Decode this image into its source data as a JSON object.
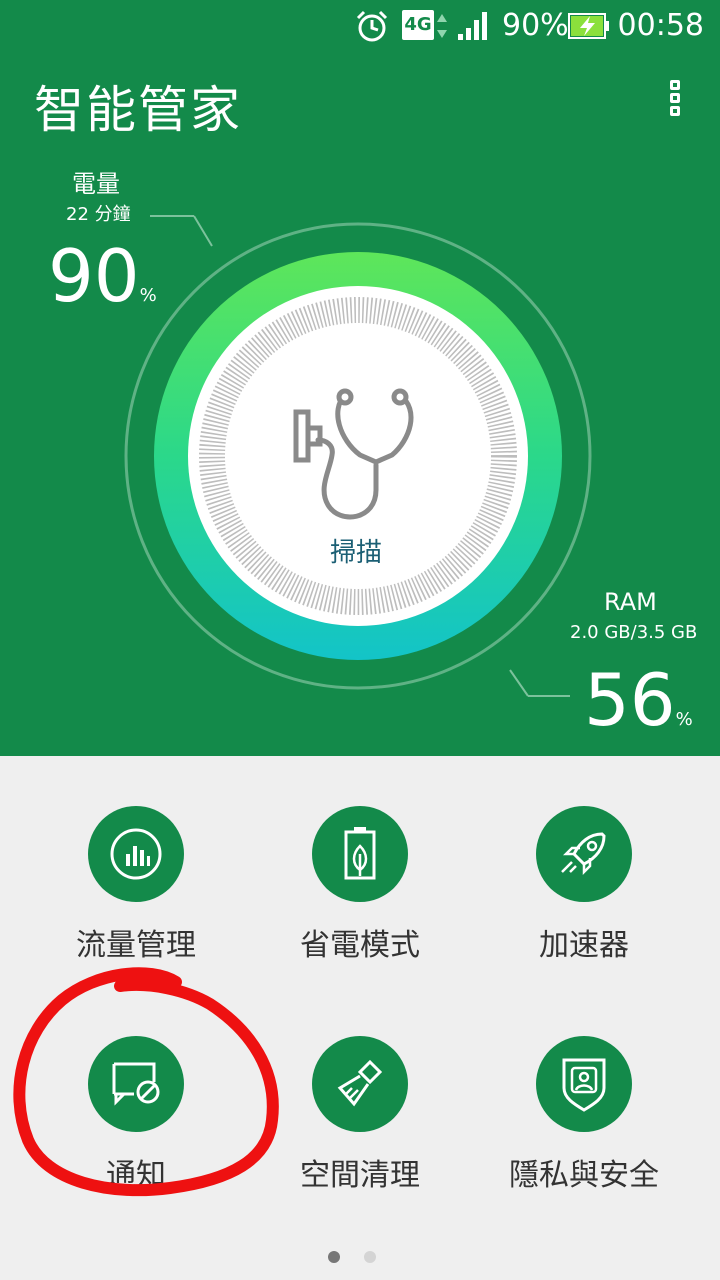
{
  "status_bar": {
    "network": "4G",
    "battery_percent": "90%",
    "time": "00:58"
  },
  "app": {
    "title": "智能管家"
  },
  "battery": {
    "label": "電量",
    "time_remaining": "22 分鐘",
    "value": "90",
    "unit": "%"
  },
  "ram": {
    "label": "RAM",
    "usage": "2.0 GB/3.5 GB",
    "value": "56",
    "unit": "%"
  },
  "scan": {
    "label": "掃描"
  },
  "tiles": [
    {
      "label": "流量管理",
      "icon": "bar-chart-icon"
    },
    {
      "label": "省電模式",
      "icon": "battery-leaf-icon"
    },
    {
      "label": "加速器",
      "icon": "rocket-icon"
    },
    {
      "label": "通知",
      "icon": "message-block-icon"
    },
    {
      "label": "空間清理",
      "icon": "broom-icon"
    },
    {
      "label": "隱私與安全",
      "icon": "shield-user-icon"
    }
  ],
  "page_indicator": {
    "current": 1,
    "total": 2
  },
  "colors": {
    "primary": "#138a4a",
    "gauge_top": "#5ee65a",
    "gauge_bottom": "#13c4c8",
    "annotation": "#ee1111"
  }
}
